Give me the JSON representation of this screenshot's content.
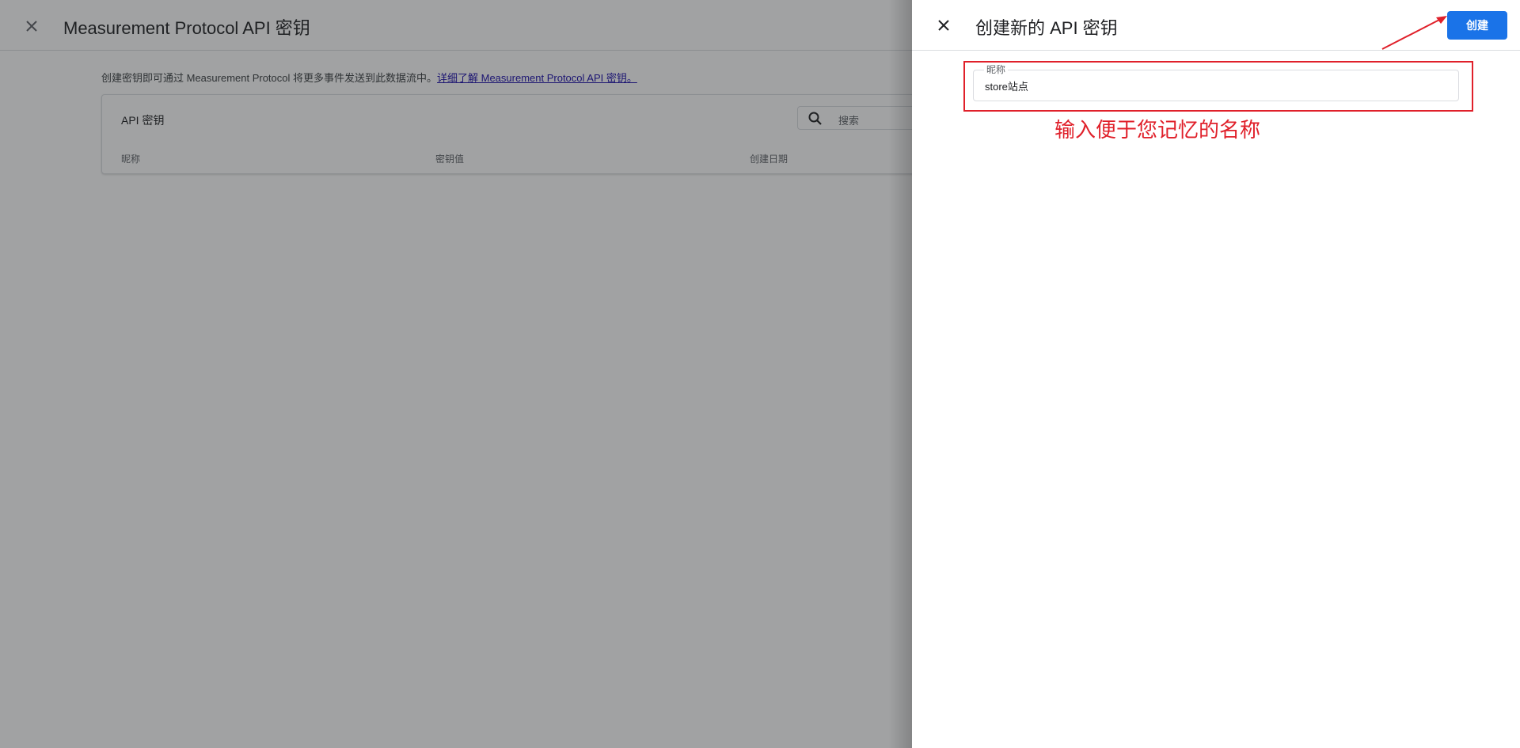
{
  "background": {
    "title": "Measurement Protocol API 密钥",
    "description_text": "创建密钥即可通过 Measurement Protocol 将更多事件发送到此数据流中。",
    "description_link": "详细了解 Measurement Protocol API 密钥。",
    "card_title": "API 密钥",
    "search_placeholder": "搜索",
    "columns": [
      "昵称",
      "密钥值",
      "创建日期"
    ]
  },
  "panel": {
    "title": "创建新的 API 密钥",
    "create_label": "创建",
    "nickname_label": "昵称",
    "nickname_value": "store站点"
  },
  "annotation": {
    "text": "输入便于您记忆的名称",
    "color": "#e0202a"
  },
  "colors": {
    "primary_button": "#1a73e8",
    "link": "#1a0dab"
  }
}
